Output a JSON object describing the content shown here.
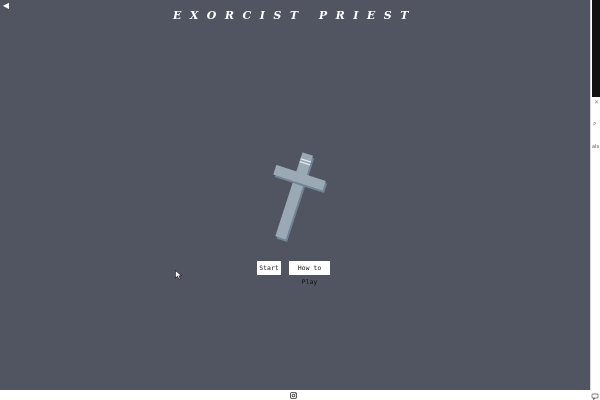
{
  "game": {
    "title": "EXORCIST PRIEST",
    "back_icon": "back-arrow-icon",
    "emblem": "cross-icon"
  },
  "menu": {
    "start_label": "Start",
    "howto_label": "How to Play"
  },
  "sidebar": {
    "text_fragment": "als",
    "search_icon": "search-icon",
    "close_icon": "close-icon"
  },
  "footer": {
    "social_icon": "instagram-icon"
  },
  "colors": {
    "background": "#515461",
    "cross_light": "#9aa9b4",
    "cross_dark": "#6f8494",
    "button_bg": "#ffffff",
    "title_color": "#ffffff"
  }
}
